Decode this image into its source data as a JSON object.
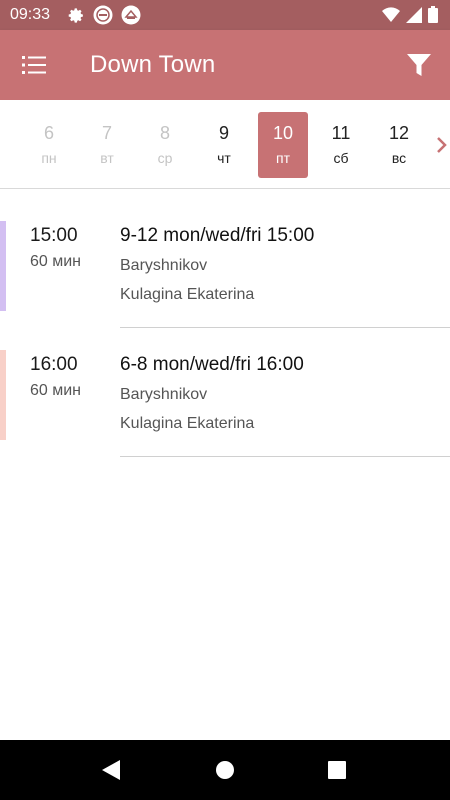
{
  "status_bar": {
    "time": "09:33",
    "icons_left": [
      "gear-icon",
      "app-logo-icon",
      "app-logo-icon"
    ],
    "icons_right": [
      "wifi-icon",
      "cellular-signal-icon",
      "battery-icon"
    ]
  },
  "app_bar": {
    "title": "Down Town",
    "menu_icon": "list-menu-icon",
    "filter_icon": "filter-icon"
  },
  "days": [
    {
      "num": "6",
      "weekday": "пн",
      "state": "past"
    },
    {
      "num": "7",
      "weekday": "вт",
      "state": "past"
    },
    {
      "num": "8",
      "weekday": "ср",
      "state": "past"
    },
    {
      "num": "9",
      "weekday": "чт",
      "state": "future"
    },
    {
      "num": "10",
      "weekday": "пт",
      "state": "selected"
    },
    {
      "num": "11",
      "weekday": "сб",
      "state": "future"
    },
    {
      "num": "12",
      "weekday": "вс",
      "state": "future"
    }
  ],
  "lessons": [
    {
      "time": "15:00",
      "duration": "60 мин",
      "title": "9-12 mon/wed/fri 15:00",
      "line1": "Baryshnikov",
      "line2": "Kulagina Ekaterina",
      "color": "#d3bff2"
    },
    {
      "time": "16:00",
      "duration": "60 мин",
      "title": "6-8 mon/wed/fri 16:00",
      "line1": "Baryshnikov",
      "line2": "Kulagina Ekaterina",
      "color": "#f8d0c8"
    }
  ],
  "colors": {
    "status_bar": "#a45e60",
    "app_bar": "#c77274",
    "selected_day": "#c77274",
    "accent_arrow": "#c77274"
  }
}
